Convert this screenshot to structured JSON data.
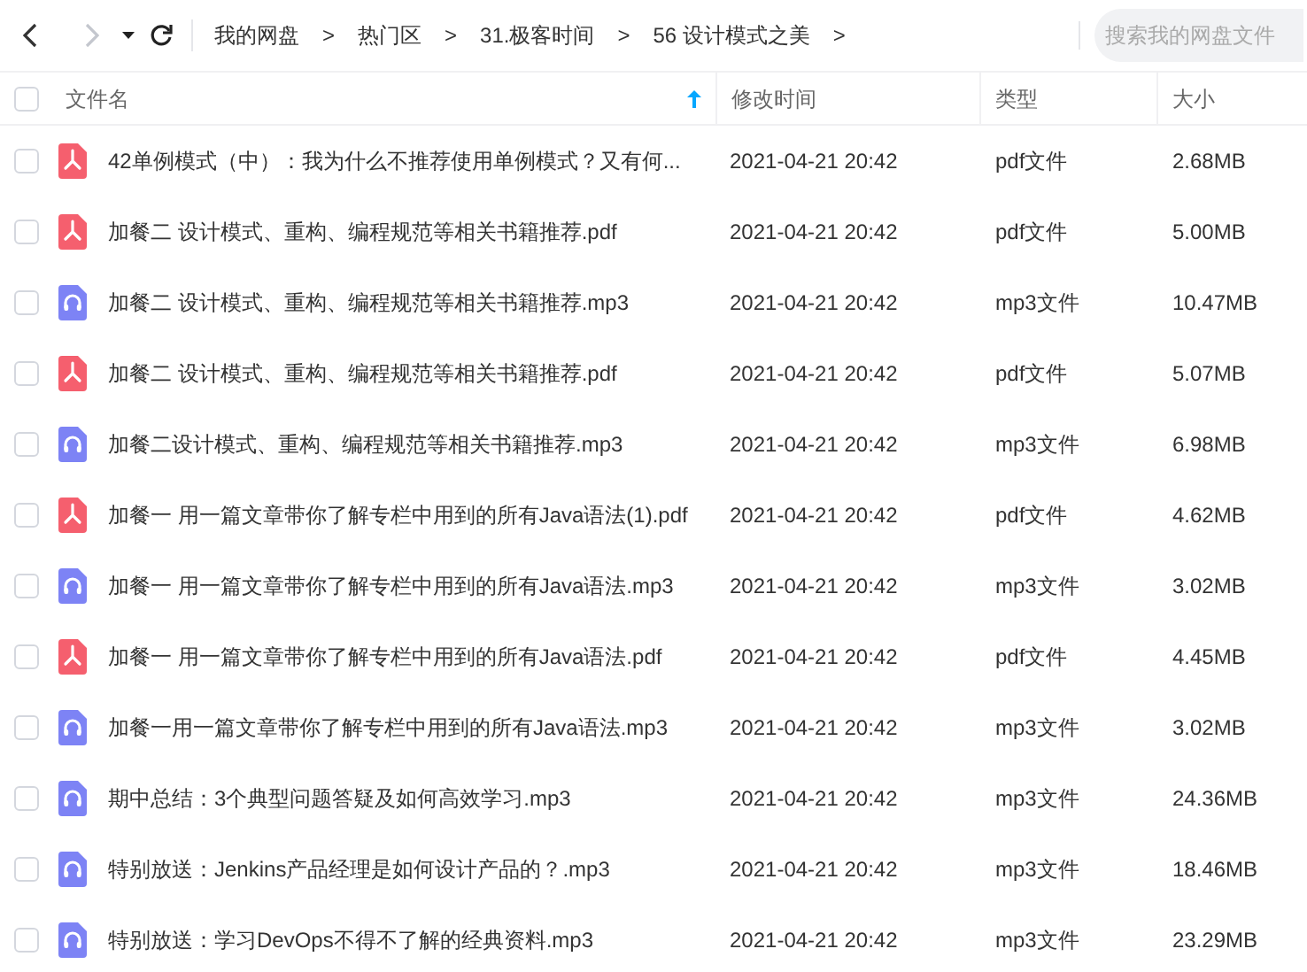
{
  "toolbar": {
    "back": {
      "disabled": false
    },
    "forward": {
      "disabled": true
    },
    "breadcrumb": [
      {
        "label": "我的网盘",
        "separator": ">"
      },
      {
        "label": "热门区",
        "separator": ">"
      },
      {
        "label": "31.极客时间",
        "separator": ">"
      },
      {
        "label": "56 设计模式之美",
        "separator": ">"
      }
    ],
    "search": {
      "placeholder": "搜索我的网盘文件"
    }
  },
  "table": {
    "select_all": {
      "checked": false
    },
    "columns": [
      {
        "label": "文件名",
        "sorted": true
      },
      {
        "label": "修改时间",
        "sorted": false
      },
      {
        "label": "类型",
        "sorted": false
      },
      {
        "label": "大小",
        "sorted": false
      }
    ],
    "rows": [
      {
        "kind": "pdf",
        "checked": false,
        "name": "42单例模式（中）：我为什么不推荐使用单例模式？又有何...",
        "modified": "2021-04-21 20:42",
        "type": "pdf文件",
        "size": "2.68MB"
      },
      {
        "kind": "pdf",
        "checked": false,
        "name": "加餐二  设计模式、重构、编程规范等相关书籍推荐.pdf",
        "modified": "2021-04-21 20:42",
        "type": "pdf文件",
        "size": "5.00MB"
      },
      {
        "kind": "audio",
        "checked": false,
        "name": "加餐二 设计模式、重构、编程规范等相关书籍推荐.mp3",
        "modified": "2021-04-21 20:42",
        "type": "mp3文件",
        "size": "10.47MB"
      },
      {
        "kind": "pdf",
        "checked": false,
        "name": "加餐二 设计模式、重构、编程规范等相关书籍推荐.pdf",
        "modified": "2021-04-21 20:42",
        "type": "pdf文件",
        "size": "5.07MB"
      },
      {
        "kind": "audio",
        "checked": false,
        "name": "加餐二设计模式、重构、编程规范等相关书籍推荐.mp3",
        "modified": "2021-04-21 20:42",
        "type": "mp3文件",
        "size": "6.98MB"
      },
      {
        "kind": "pdf",
        "checked": false,
        "name": "加餐一 用一篇文章带你了解专栏中用到的所有Java语法(1).pdf",
        "modified": "2021-04-21 20:42",
        "type": "pdf文件",
        "size": "4.62MB"
      },
      {
        "kind": "audio",
        "checked": false,
        "name": "加餐一 用一篇文章带你了解专栏中用到的所有Java语法.mp3",
        "modified": "2021-04-21 20:42",
        "type": "mp3文件",
        "size": "3.02MB"
      },
      {
        "kind": "pdf",
        "checked": false,
        "name": "加餐一 用一篇文章带你了解专栏中用到的所有Java语法.pdf",
        "modified": "2021-04-21 20:42",
        "type": "pdf文件",
        "size": "4.45MB"
      },
      {
        "kind": "audio",
        "checked": false,
        "name": "加餐一用一篇文章带你了解专栏中用到的所有Java语法.mp3",
        "modified": "2021-04-21 20:42",
        "type": "mp3文件",
        "size": "3.02MB"
      },
      {
        "kind": "audio",
        "checked": false,
        "name": "期中总结：3个典型问题答疑及如何高效学习.mp3",
        "modified": "2021-04-21 20:42",
        "type": "mp3文件",
        "size": "24.36MB"
      },
      {
        "kind": "audio",
        "checked": false,
        "name": "特别放送：Jenkins产品经理是如何设计产品的？.mp3",
        "modified": "2021-04-21 20:42",
        "type": "mp3文件",
        "size": "18.46MB"
      },
      {
        "kind": "audio",
        "checked": false,
        "name": "特别放送：学习DevOps不得不了解的经典资料.mp3",
        "modified": "2021-04-21 20:42",
        "type": "mp3文件",
        "size": "23.29MB"
      }
    ]
  }
}
